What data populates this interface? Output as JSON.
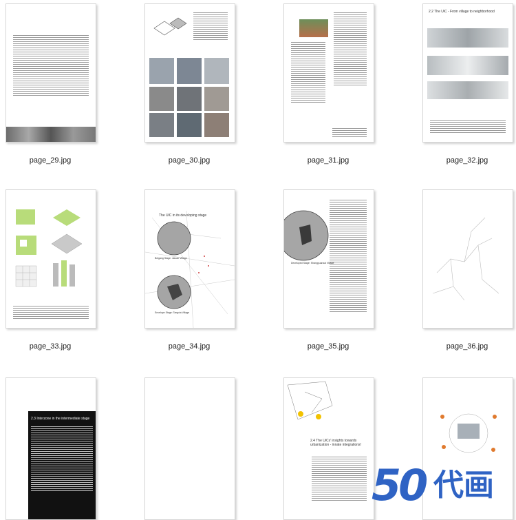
{
  "thumbnails": [
    {
      "caption": "page_29.jpg"
    },
    {
      "caption": "page_30.jpg"
    },
    {
      "caption": "page_31.jpg"
    },
    {
      "caption": "page_32.jpg"
    },
    {
      "caption": "page_33.jpg"
    },
    {
      "caption": "page_34.jpg"
    },
    {
      "caption": "page_35.jpg"
    },
    {
      "caption": "page_36.jpg"
    }
  ],
  "page_headings": {
    "page_32": "2.2 The UiC - From village to neighborhood",
    "page_34": "The UiC in its developing stage",
    "page_37": "2.3 Interzone in the intermediate stage",
    "page_39": "2.4 The UiCs' insights towards urbanization - innate integrations!"
  },
  "map_labels": {
    "page_34_a": "Beigang Stage: Jiaoan Village",
    "page_34_b": "Envelope Stage: Tangxia Village",
    "page_35": "Developed Stage: Shangyuanzai Village"
  },
  "watermark": {
    "number": "50",
    "text": "代画"
  },
  "colors": {
    "accent_green": "#b8dc7a",
    "watermark_blue": "#2f63c4"
  }
}
